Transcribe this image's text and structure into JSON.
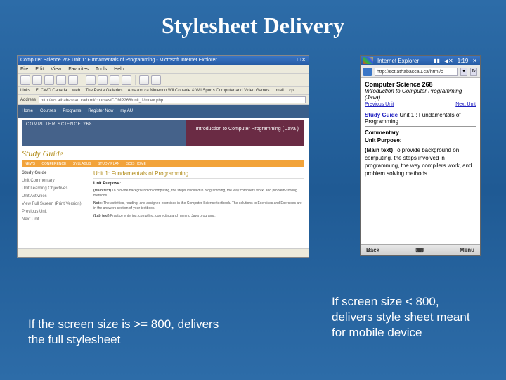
{
  "slide_title": "Stylesheet Delivery",
  "caption_left": "If the screen size is >= 800, delivers the full stylesheet",
  "caption_right": "If screen size < 800, delivers style sheet meant for mobile device",
  "desktop": {
    "window_title": "Computer Science 268 Unit 1: Fundamentals of Programming - Microsoft Internet Explorer",
    "menu": {
      "file": "File",
      "edit": "Edit",
      "view": "View",
      "favorites": "Favorites",
      "tools": "Tools",
      "help": "Help"
    },
    "links_label": "Links",
    "links": [
      "ELCWO Canada",
      "web",
      "The Pasta Galleries",
      "Amazon.ca Nintendo Wii Console & Wii Sports Computer and Video Games",
      "tmail",
      "cpl"
    ],
    "address_label": "Address",
    "address_value": "http://ws.athabascau.ca/html/courses/COMP268/unit_1/index.php",
    "header_nav": {
      "home": "Home",
      "courses": "Courses",
      "programs": "Programs",
      "register": "Register Now",
      "myau": "my AU"
    },
    "banner_left": "COMPUTER SCIENCE 268",
    "banner_right": "Introduction to Computer Programming ( Java )",
    "study_guide": "Study Guide",
    "tabs": {
      "news": "NEWS",
      "conference": "CONFERENCE",
      "syllabus": "SYLLABUS",
      "study_plan": "STUDY PLAN",
      "scis": "SCIS HOME"
    },
    "side": {
      "hdr": "Study Guide",
      "i1": "Unit Commentary",
      "i2": "Unit Learning Objectives",
      "i3": "Unit Activities",
      "i4": "View Full Screen (Print Version)",
      "i5": "Previous Unit",
      "i6": "Next Unit"
    },
    "main": {
      "unit_title": "Unit 1: Fundamentals of Programming",
      "purpose": "Unit Purpose:",
      "p1_label": "(Main text)",
      "p1": " To provide background on computing, the steps involved in programming, the way compilers work, and problem-solving methods.",
      "p2_label": "Note:",
      "p2": " The activities, reading, and assigned exercises in the Computer Science textbook. The solutions to Exercises and Exercises are in the answers section of your textbook.",
      "p3_label": "(Lab text)",
      "p3": " Practice entering, compiling, correcting and running Java programs."
    }
  },
  "mobile": {
    "sys_title": "Internet Explorer",
    "sys_time": "1:19",
    "address": "http://sct.athabascau.ca/html/c",
    "course_title": "Computer Science 268",
    "course_sub": "Introduction to Computer Programming (Java)",
    "prev": "Previous Unit",
    "next": "Next Unit",
    "sg_link": "Study Guide",
    "sg_rest": " Unit 1 : Fundamentals of Programming",
    "sec1": "Commentary",
    "sec2": "Unit Purpose:",
    "body_label": "(Main text)",
    "body": " To provide background on computing, the steps involved in programming, the way compilers work, and problem solving methods.",
    "soft_left": "Back",
    "soft_right": "Menu"
  }
}
